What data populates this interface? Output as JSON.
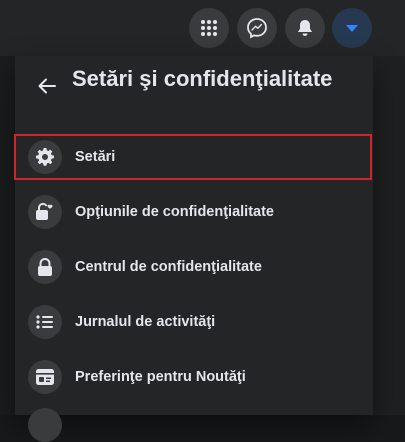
{
  "header": {
    "buttons": [
      {
        "name": "menu-grid-button",
        "icon": "grid-icon"
      },
      {
        "name": "messenger-button",
        "icon": "messenger-icon"
      },
      {
        "name": "notifications-button",
        "icon": "bell-icon"
      },
      {
        "name": "account-button",
        "icon": "caret-down-icon",
        "active": true
      }
    ]
  },
  "panel": {
    "title": "Setări şi confidenţialitate",
    "back_icon": "back-arrow-icon",
    "items": [
      {
        "label": "Setări",
        "icon": "gear-icon",
        "selected": true
      },
      {
        "label": "Opţiunile de confidenţialitate",
        "icon": "lock-heart-icon"
      },
      {
        "label": "Centrul de confidenţialitate",
        "icon": "lock-icon"
      },
      {
        "label": "Jurnalul de activităţi",
        "icon": "list-icon"
      },
      {
        "label": "Preferinţe pentru Noutăţi",
        "icon": "feed-icon"
      }
    ]
  },
  "colors": {
    "accent": "#2d88ff",
    "highlight_border": "#d0242b",
    "text": "#e4e6eb",
    "panel_bg": "#242526",
    "icon_bg": "#3a3b3c"
  }
}
